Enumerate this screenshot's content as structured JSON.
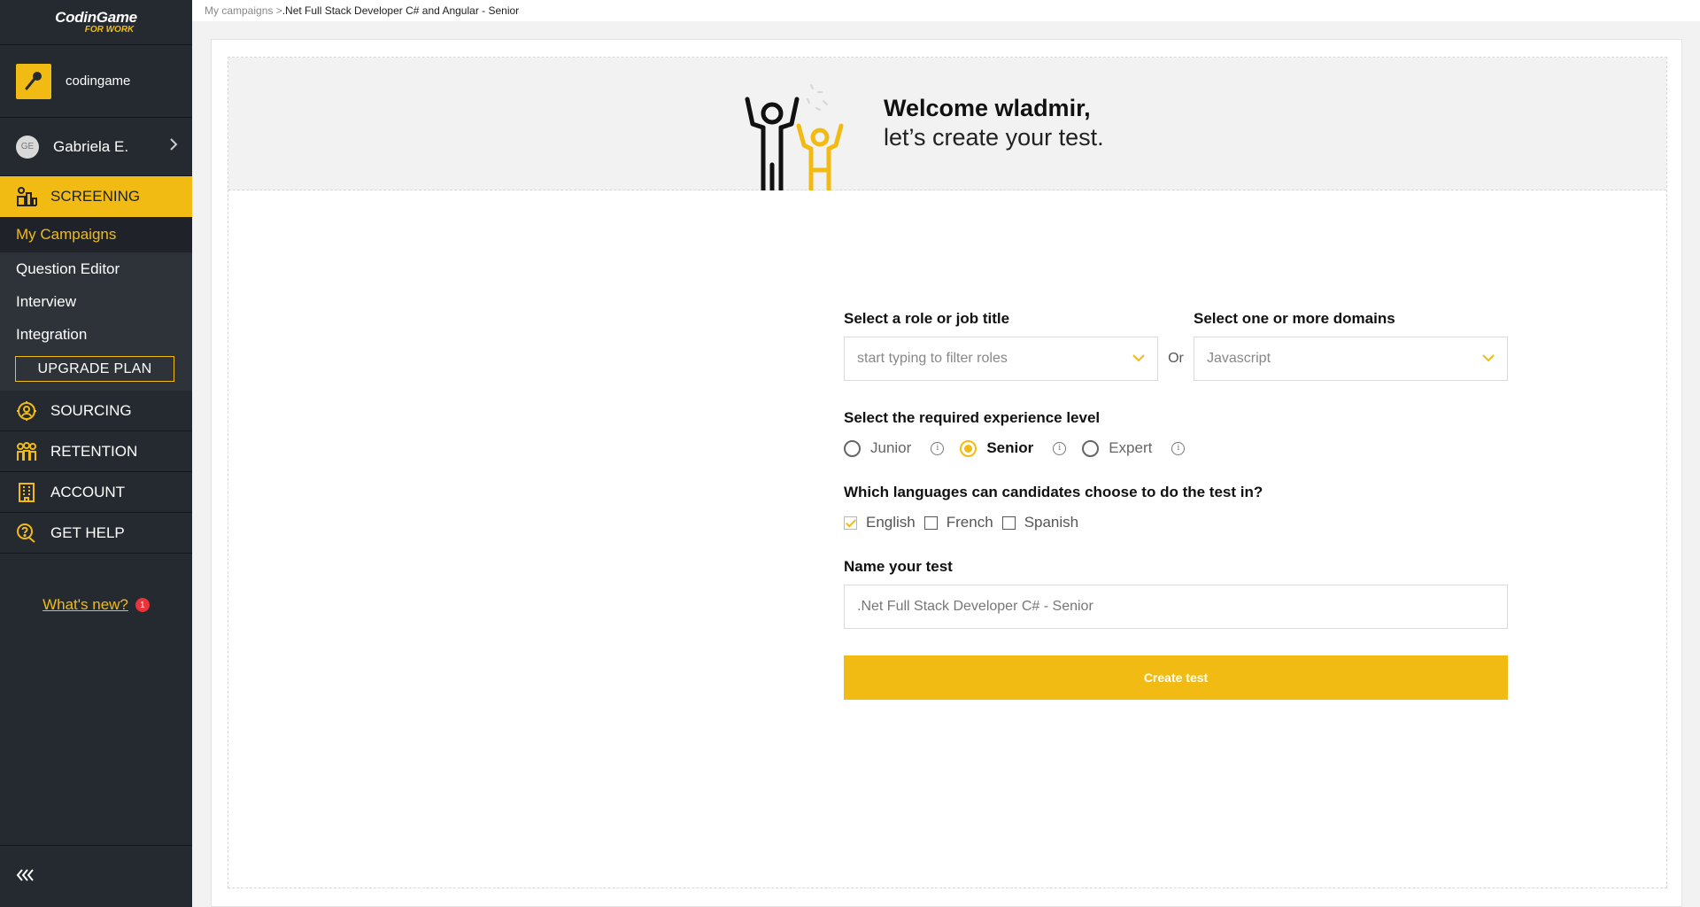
{
  "app": {
    "logo_main": "CodinGame",
    "logo_sub": "FOR WORK",
    "accent_color": "#f2bb13",
    "sidebar_bg": "#252a31"
  },
  "sidebar": {
    "org_name": "codingame",
    "user_initials": "GE",
    "user_name": "Gabriela E.",
    "screening": {
      "label": "SCREENING",
      "icon": "screening-icon",
      "items": [
        {
          "label": "My Campaigns",
          "selected": true
        },
        {
          "label": "Question Editor"
        },
        {
          "label": "Interview"
        },
        {
          "label": "Integration"
        }
      ],
      "upgrade_label": "UPGRADE PLAN"
    },
    "nav": [
      {
        "label": "SOURCING",
        "icon": "sourcing-icon"
      },
      {
        "label": "RETENTION",
        "icon": "retention-icon"
      },
      {
        "label": "ACCOUNT",
        "icon": "building-icon"
      },
      {
        "label": "GET HELP",
        "icon": "help-icon"
      }
    ],
    "whats_new": "What's new?",
    "whats_new_count": "1",
    "collapse_icon": "«‹"
  },
  "breadcrumb": {
    "parent": "My campaigns >",
    "current": ".Net Full Stack Developer C# and Angular - Senior"
  },
  "welcome": {
    "title": "Welcome wladmir,",
    "subtitle": "let’s create your test."
  },
  "form": {
    "role_label": "Select a role or job title",
    "role_placeholder": "start typing to filter roles",
    "or_label": "Or",
    "domain_label": "Select one or more domains",
    "domain_value": "Javascript",
    "experience_label": "Select the required experience level",
    "experience_levels": [
      {
        "label": "Junior",
        "selected": false
      },
      {
        "label": "Senior",
        "selected": true
      },
      {
        "label": "Expert",
        "selected": false
      }
    ],
    "languages_label": "Which languages can candidates choose to do the test in?",
    "languages": [
      {
        "label": "English",
        "checked": true
      },
      {
        "label": "French",
        "checked": false
      },
      {
        "label": "Spanish",
        "checked": false
      }
    ],
    "name_label": "Name your test",
    "name_placeholder": ".Net Full Stack Developer C# - Senior",
    "create_button": "Create test"
  }
}
